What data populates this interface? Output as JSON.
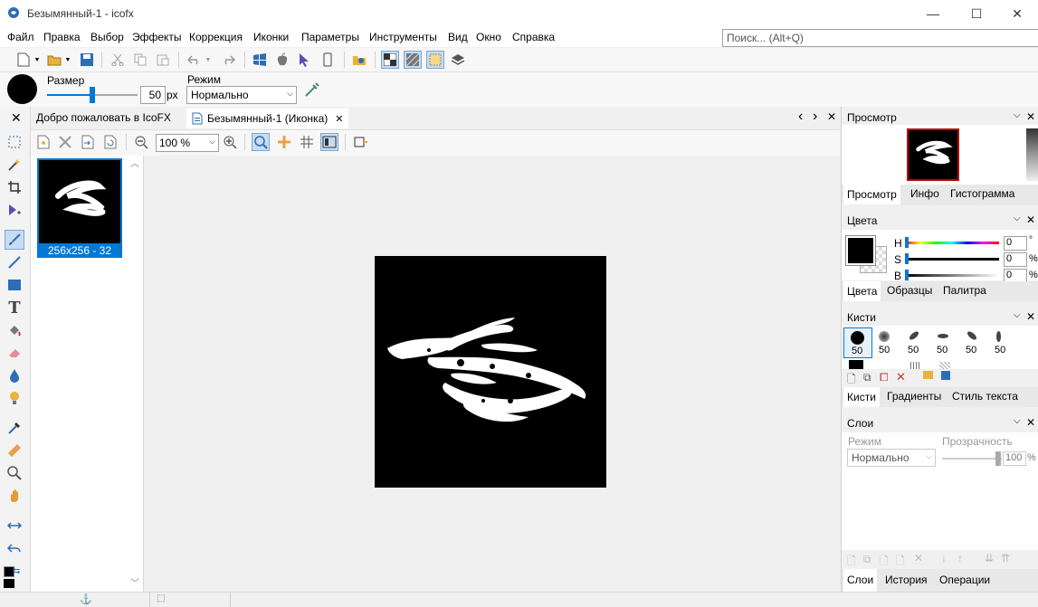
{
  "window": {
    "title": "Безымянный-1 - icofx",
    "minimize": "—",
    "maximize": "☐",
    "close": "✕"
  },
  "menu": {
    "items": [
      "Файл",
      "Правка",
      "Выбор",
      "Эффекты",
      "Коррекция",
      "Иконки",
      "Параметры",
      "Инструменты",
      "Вид",
      "Окно",
      "Справка"
    ],
    "search_placeholder": "Поиск... (Alt+Q)"
  },
  "options": {
    "size_label": "Размер",
    "size_value": "50",
    "size_unit": "px",
    "size_slider_fraction": 0.5,
    "mode_label": "Режим",
    "mode_value": "Нормально"
  },
  "tabs": {
    "welcome": "Добро пожаловать в IcoFX",
    "document": "Безымянный-1 (Иконка)",
    "nav_prev": "‹",
    "nav_next": "›",
    "close": "✕"
  },
  "doc_toolbar": {
    "zoom": "100 %"
  },
  "thumb": {
    "label": "256x256 - 32"
  },
  "preview_panel": {
    "title": "Просмотр",
    "tabs": [
      "Просмотр",
      "Инфо",
      "Гистограмма"
    ]
  },
  "colors_panel": {
    "title": "Цвета",
    "h_label": "H",
    "s_label": "S",
    "b_label": "B",
    "h_value": "0",
    "s_value": "0",
    "b_value": "0",
    "h_unit": "°",
    "s_unit": "%",
    "b_unit": "%",
    "tabs": [
      "Цвета",
      "Образцы",
      "Палитра"
    ]
  },
  "brushes_panel": {
    "title": "Кисти",
    "sizes": [
      "50",
      "50",
      "50",
      "50",
      "50",
      "50"
    ],
    "tabs": [
      "Кисти",
      "Градиенты",
      "Стиль текста"
    ]
  },
  "layers_panel": {
    "title": "Слои",
    "mode_label": "Режим",
    "opacity_label": "Прозрачность",
    "mode_value": "Нормально",
    "opacity_value": "100",
    "opacity_unit": "%",
    "tabs": [
      "Слои",
      "История",
      "Операции"
    ]
  },
  "colors": {
    "accent": "#0078d7",
    "canvas_bg": "#000000",
    "preview_border": "#c00000"
  }
}
